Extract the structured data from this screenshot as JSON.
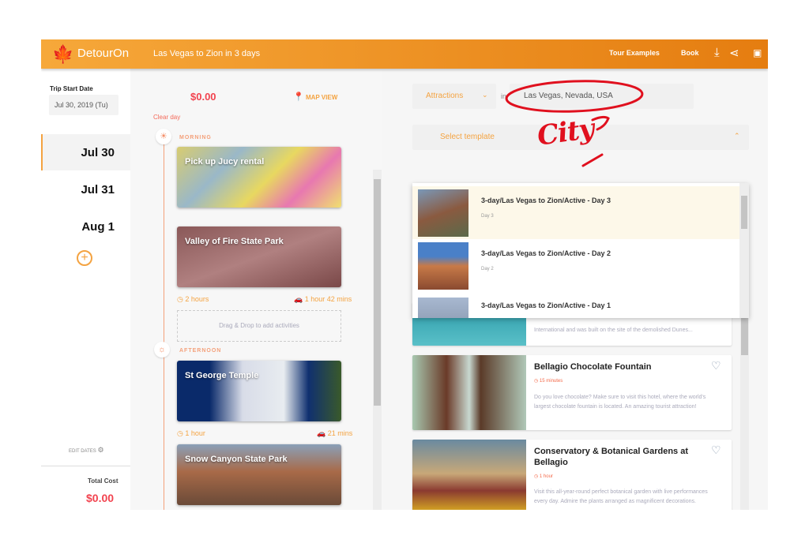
{
  "header": {
    "brand": "DetourOn",
    "trip_title": "Las Vegas to Zion in 3 days",
    "nav": [
      "Tour Examples",
      "Book"
    ],
    "icons": [
      "download-icon",
      "share-icon",
      "save-icon"
    ]
  },
  "sidebar": {
    "start_label": "Trip Start Date",
    "start_value": "Jul 30, 2019 (Tu)",
    "days": [
      "Jul 30",
      "Jul 31",
      "Aug 1"
    ],
    "edit_dates": "EDIT DATES",
    "total_label": "Total Cost",
    "total_value": "$0.00"
  },
  "day_plan": {
    "cost": "$0.00",
    "map_view": "MAP VIEW",
    "clear_day": "Clear day",
    "morning": "MORNING",
    "afternoon": "AFTERNOON",
    "drop_hint": "Drag & Drop to add activities",
    "activities": [
      {
        "name": "Pick up Jucy rental"
      },
      {
        "name": "Valley of Fire State Park",
        "duration": "2 hours",
        "drive": "1 hour 42 mins"
      },
      {
        "name": "St George Temple",
        "duration": "1 hour",
        "drive": "21 mins"
      },
      {
        "name": "Snow Canyon State Park"
      }
    ]
  },
  "search": {
    "category": "Attractions",
    "in": "in",
    "location": "Las Vegas, Nevada, USA",
    "template_placeholder": "Select template"
  },
  "templates": [
    {
      "name": "3-day/Las Vegas to Zion/Active - Day 3",
      "sub": "Day 3"
    },
    {
      "name": "3-day/Las Vegas to Zion/Active - Day 2",
      "sub": "Day 2"
    },
    {
      "name": "3-day/Las Vegas to Zion/Active - Day 1"
    }
  ],
  "attractions": [
    {
      "desc": "International and was built on the site of the demolished Dunes..."
    },
    {
      "name": "Bellagio Chocolate Fountain",
      "duration": "15 minutes",
      "desc": "Do you love chocolate? Make sure to visit this hotel, where the world's largest chocolate fountain is located. An amazing tourist attraction!"
    },
    {
      "name": "Conservatory & Botanical Gardens at Bellagio",
      "duration": "1 hour",
      "desc": "Visit this all-year-round perfect botanical garden with live performances every day. Admire the plants arranged as magnificent decorations."
    }
  ],
  "annotation": {
    "text": "City"
  },
  "colors": {
    "accent": "#f4a341",
    "header_start": "#f6a83a",
    "header_end": "#e57d10",
    "price": "#f2434f",
    "annotation": "#e0101e"
  }
}
